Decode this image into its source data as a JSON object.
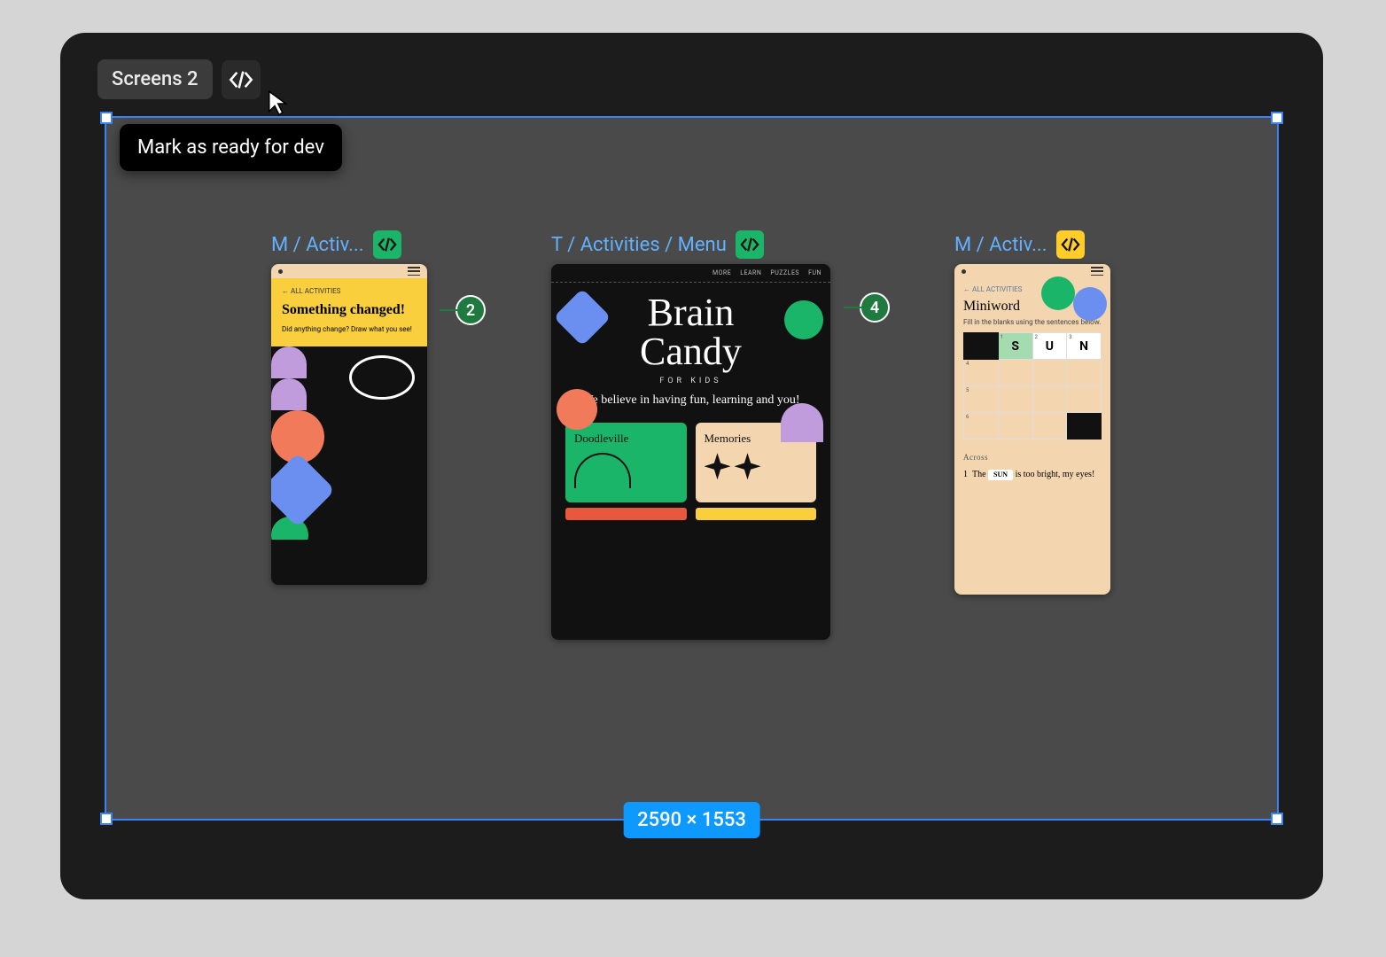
{
  "section": {
    "label": "Screens 2"
  },
  "tooltip": {
    "text": "Mark as ready for dev"
  },
  "selection": {
    "dimensions": "2590 × 1553"
  },
  "annotations": [
    {
      "count": "2"
    },
    {
      "count": "4"
    }
  ],
  "frames": [
    {
      "label": "M / Activ...",
      "dev_badge_color": "green",
      "content": {
        "back": "←  ALL ACTIVITIES",
        "title": "Something changed!",
        "sub": "Did anything change? Draw what you see!"
      }
    },
    {
      "label": "T / Activities / Menu",
      "dev_badge_color": "green",
      "content": {
        "nav": [
          "MORE",
          "LEARN",
          "PUZZLES",
          "FUN"
        ],
        "brand_line1": "Brain",
        "brand_line2": "Candy",
        "for": "FOR KIDS",
        "tagline": "We believe in having fun, learning and you!",
        "card1": "Doodleville",
        "card2": "Memories"
      }
    },
    {
      "label": "M / Activ...",
      "dev_badge_color": "yellow",
      "content": {
        "back": "←  ALL ACTIVITIES",
        "title": "Miniword",
        "sub": "Fill in the blanks using the sentences below.",
        "letters": {
          "a": "S",
          "b": "U",
          "c": "N"
        },
        "clue_header": "Across",
        "clue_num": "1",
        "clue_pre": "The",
        "clue_blank": "SUN",
        "clue_post": "is too bright, my eyes!"
      }
    }
  ]
}
